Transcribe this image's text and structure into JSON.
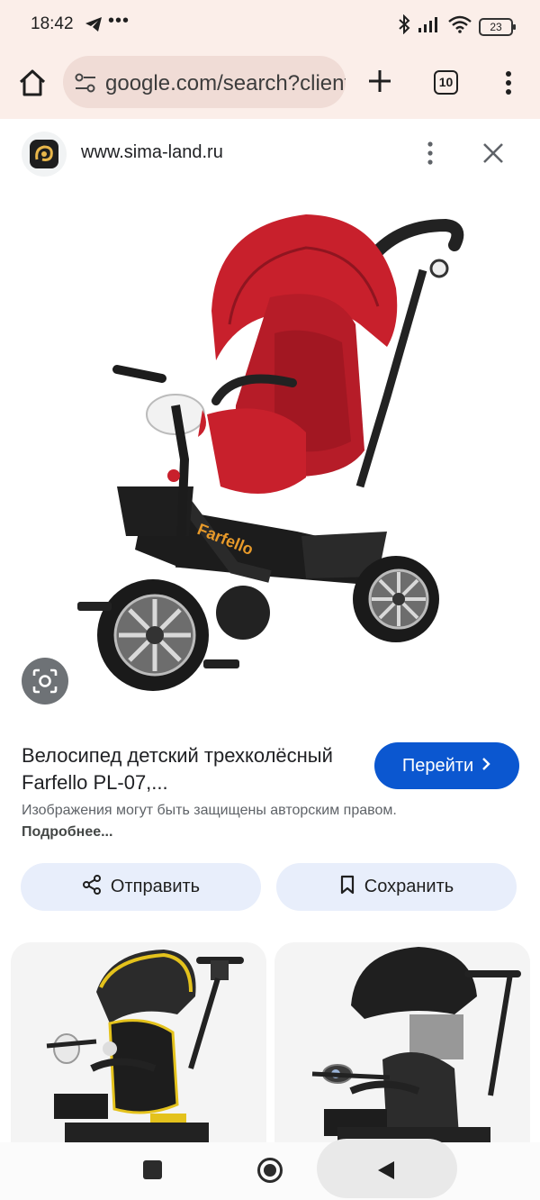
{
  "status": {
    "time": "18:42",
    "more": "•••",
    "battery": "23"
  },
  "browser": {
    "url": "google.com/search?client",
    "tabs_count": "10"
  },
  "sheet": {
    "site_url": "www.sima-land.ru",
    "title": "Велосипед детский трехколёсный Farfello PL-07,...",
    "go_label": "Перейти",
    "copyright_text": "Изображения могут быть защищены авторским правом.",
    "copyright_more": "Подробнее...",
    "share_label": "Отправить",
    "save_label": "Сохранить",
    "brand_text": "Farfello"
  },
  "colors": {
    "accent": "#0b57d0",
    "chrome_bg": "#fbeee9",
    "action_bg": "#e8eefb"
  }
}
